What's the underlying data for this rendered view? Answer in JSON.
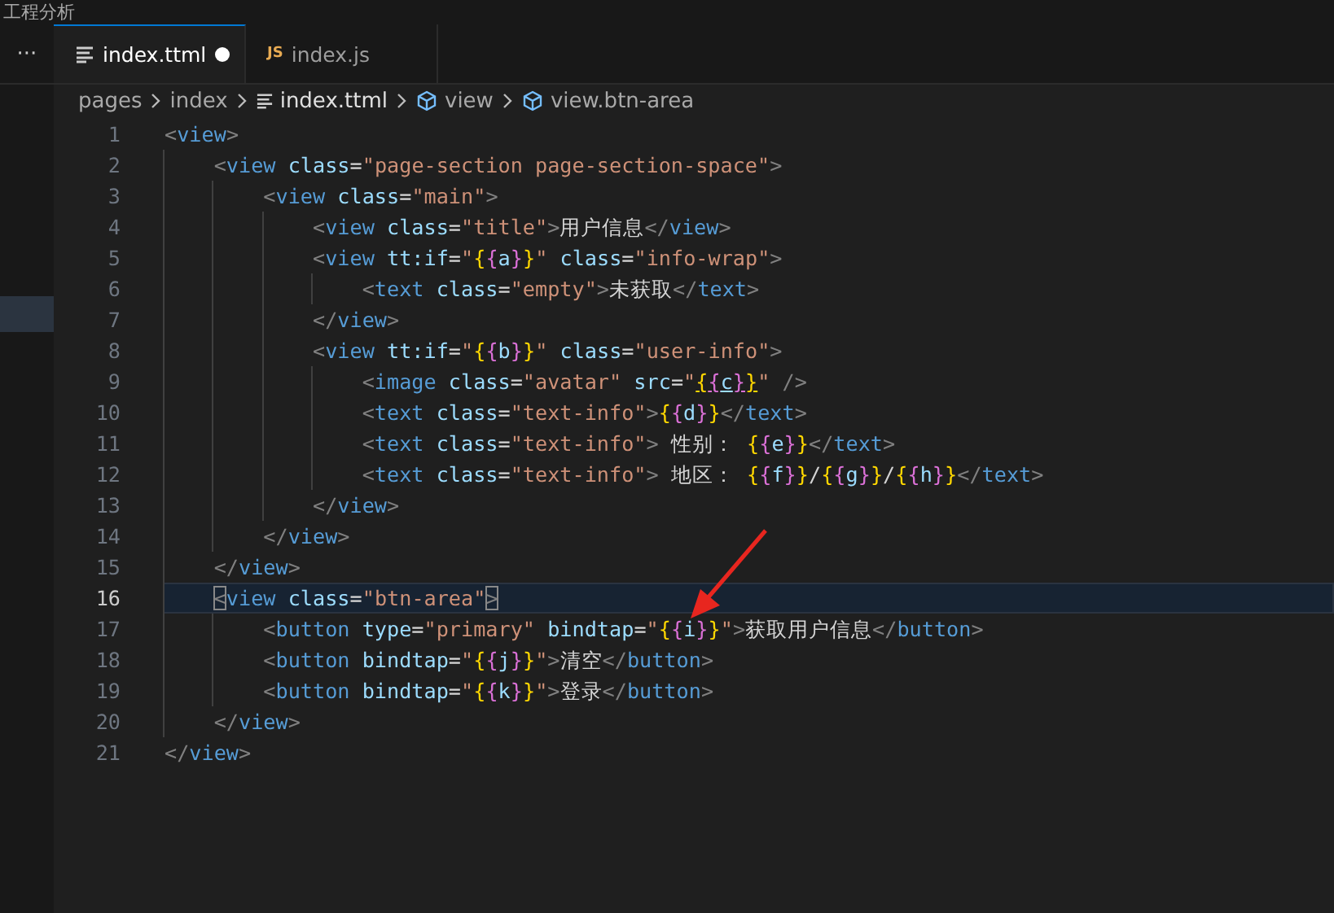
{
  "window": {
    "title": "工程分析"
  },
  "sidebar": {
    "more": "···"
  },
  "tabs": [
    {
      "label": "index.ttml",
      "kind": "markup",
      "selected": true,
      "modified": true
    },
    {
      "label": "index.js",
      "kind": "script",
      "badge": "JS",
      "selected": false,
      "modified": false
    }
  ],
  "breadcrumbs": [
    {
      "label": "pages",
      "kind": "folder"
    },
    {
      "label": "index",
      "kind": "folder"
    },
    {
      "label": "index.ttml",
      "kind": "file"
    },
    {
      "label": "view",
      "kind": "symbol"
    },
    {
      "label": "view.btn-area",
      "kind": "symbol"
    }
  ],
  "code": [
    {
      "number": "1",
      "selected": false,
      "tokens": [
        {
          "kind": "punct",
          "text": "<"
        },
        {
          "kind": "tag",
          "text": "view"
        },
        {
          "kind": "punct",
          "text": ">"
        }
      ],
      "children": [
        {
          "number": "2",
          "selected": false,
          "tokens": [
            {
              "kind": "punct",
              "text": "<"
            },
            {
              "kind": "tag",
              "text": "view"
            },
            {
              "kind": "attr",
              "text": " class"
            },
            {
              "kind": "op",
              "text": "="
            },
            {
              "kind": "str",
              "text": "\"page-section page-section-space\""
            },
            {
              "kind": "punct",
              "text": ">"
            }
          ],
          "children": [
            {
              "number": "3",
              "selected": false,
              "tokens": [
                {
                  "kind": "punct",
                  "text": "<"
                },
                {
                  "kind": "tag",
                  "text": "view"
                },
                {
                  "kind": "attr",
                  "text": " class"
                },
                {
                  "kind": "op",
                  "text": "="
                },
                {
                  "kind": "str",
                  "text": "\"main\""
                },
                {
                  "kind": "punct",
                  "text": ">"
                }
              ],
              "children": [
                {
                  "number": "4",
                  "selected": false,
                  "tokens": [
                    {
                      "kind": "punct",
                      "text": "<"
                    },
                    {
                      "kind": "tag",
                      "text": "view"
                    },
                    {
                      "kind": "attr",
                      "text": " class"
                    },
                    {
                      "kind": "op",
                      "text": "="
                    },
                    {
                      "kind": "str",
                      "text": "\"title\""
                    },
                    {
                      "kind": "punct",
                      "text": ">"
                    },
                    {
                      "kind": "plain",
                      "text": "用户信息"
                    },
                    {
                      "kind": "punct",
                      "text": "</"
                    },
                    {
                      "kind": "tag",
                      "text": "view"
                    },
                    {
                      "kind": "punct",
                      "text": ">"
                    }
                  ]
                },
                {
                  "number": "5",
                  "selected": false,
                  "tokens": [
                    {
                      "kind": "punct",
                      "text": "<"
                    },
                    {
                      "kind": "tag",
                      "text": "view"
                    },
                    {
                      "kind": "attr",
                      "text": " tt:if"
                    },
                    {
                      "kind": "op",
                      "text": "="
                    },
                    {
                      "kind": "str",
                      "text": "\""
                    },
                    {
                      "kind": "brace1",
                      "text": "{"
                    },
                    {
                      "kind": "brace2",
                      "text": "{"
                    },
                    {
                      "kind": "var",
                      "text": "a"
                    },
                    {
                      "kind": "brace2",
                      "text": "}"
                    },
                    {
                      "kind": "brace1",
                      "text": "}"
                    },
                    {
                      "kind": "str",
                      "text": "\""
                    },
                    {
                      "kind": "attr",
                      "text": " class"
                    },
                    {
                      "kind": "op",
                      "text": "="
                    },
                    {
                      "kind": "str",
                      "text": "\"info-wrap\""
                    },
                    {
                      "kind": "punct",
                      "text": ">"
                    }
                  ],
                  "children": [
                    {
                      "number": "6",
                      "selected": false,
                      "tokens": [
                        {
                          "kind": "punct",
                          "text": "<"
                        },
                        {
                          "kind": "tag",
                          "text": "text"
                        },
                        {
                          "kind": "attr",
                          "text": " class"
                        },
                        {
                          "kind": "op",
                          "text": "="
                        },
                        {
                          "kind": "str",
                          "text": "\"empty\""
                        },
                        {
                          "kind": "punct",
                          "text": ">"
                        },
                        {
                          "kind": "plain",
                          "text": "未获取"
                        },
                        {
                          "kind": "punct",
                          "text": "</"
                        },
                        {
                          "kind": "tag",
                          "text": "text"
                        },
                        {
                          "kind": "punct",
                          "text": ">"
                        }
                      ]
                    }
                  ]
                },
                {
                  "number": "7",
                  "selected": false,
                  "tokens": [
                    {
                      "kind": "punct",
                      "text": "</"
                    },
                    {
                      "kind": "tag",
                      "text": "view"
                    },
                    {
                      "kind": "punct",
                      "text": ">"
                    }
                  ]
                },
                {
                  "number": "8",
                  "selected": false,
                  "tokens": [
                    {
                      "kind": "punct",
                      "text": "<"
                    },
                    {
                      "kind": "tag",
                      "text": "view"
                    },
                    {
                      "kind": "attr",
                      "text": " tt:if"
                    },
                    {
                      "kind": "op",
                      "text": "="
                    },
                    {
                      "kind": "str",
                      "text": "\""
                    },
                    {
                      "kind": "brace1",
                      "text": "{"
                    },
                    {
                      "kind": "brace2",
                      "text": "{"
                    },
                    {
                      "kind": "var",
                      "text": "b"
                    },
                    {
                      "kind": "brace2",
                      "text": "}"
                    },
                    {
                      "kind": "brace1",
                      "text": "}"
                    },
                    {
                      "kind": "str",
                      "text": "\""
                    },
                    {
                      "kind": "attr",
                      "text": " class"
                    },
                    {
                      "kind": "op",
                      "text": "="
                    },
                    {
                      "kind": "str",
                      "text": "\"user-info\""
                    },
                    {
                      "kind": "punct",
                      "text": ">"
                    }
                  ],
                  "children": [
                    {
                      "number": "9",
                      "selected": false,
                      "tokens": [
                        {
                          "kind": "punct",
                          "text": "<"
                        },
                        {
                          "kind": "tag",
                          "text": "image"
                        },
                        {
                          "kind": "attr",
                          "text": " class"
                        },
                        {
                          "kind": "op",
                          "text": "="
                        },
                        {
                          "kind": "str",
                          "text": "\"avatar\""
                        },
                        {
                          "kind": "attr",
                          "text": " src"
                        },
                        {
                          "kind": "op",
                          "text": "="
                        },
                        {
                          "kind": "str",
                          "text": "\""
                        },
                        {
                          "kind": "brace1-link",
                          "text": "{"
                        },
                        {
                          "kind": "brace2-link",
                          "text": "{"
                        },
                        {
                          "kind": "var-link",
                          "text": "c"
                        },
                        {
                          "kind": "brace2-link",
                          "text": "}"
                        },
                        {
                          "kind": "brace1-link",
                          "text": "}"
                        },
                        {
                          "kind": "str",
                          "text": "\""
                        },
                        {
                          "kind": "punct",
                          "text": " />"
                        }
                      ]
                    },
                    {
                      "number": "10",
                      "selected": false,
                      "tokens": [
                        {
                          "kind": "punct",
                          "text": "<"
                        },
                        {
                          "kind": "tag",
                          "text": "text"
                        },
                        {
                          "kind": "attr",
                          "text": " class"
                        },
                        {
                          "kind": "op",
                          "text": "="
                        },
                        {
                          "kind": "str",
                          "text": "\"text-info\""
                        },
                        {
                          "kind": "punct",
                          "text": ">"
                        },
                        {
                          "kind": "brace1",
                          "text": "{"
                        },
                        {
                          "kind": "brace2",
                          "text": "{"
                        },
                        {
                          "kind": "var",
                          "text": "d"
                        },
                        {
                          "kind": "brace2",
                          "text": "}"
                        },
                        {
                          "kind": "brace1",
                          "text": "}"
                        },
                        {
                          "kind": "punct",
                          "text": "</"
                        },
                        {
                          "kind": "tag",
                          "text": "text"
                        },
                        {
                          "kind": "punct",
                          "text": ">"
                        }
                      ]
                    },
                    {
                      "number": "11",
                      "selected": false,
                      "tokens": [
                        {
                          "kind": "punct",
                          "text": "<"
                        },
                        {
                          "kind": "tag",
                          "text": "text"
                        },
                        {
                          "kind": "attr",
                          "text": " class"
                        },
                        {
                          "kind": "op",
                          "text": "="
                        },
                        {
                          "kind": "str",
                          "text": "\"text-info\""
                        },
                        {
                          "kind": "punct",
                          "text": ">"
                        },
                        {
                          "kind": "plain",
                          "text": " 性别： "
                        },
                        {
                          "kind": "brace1",
                          "text": "{"
                        },
                        {
                          "kind": "brace2",
                          "text": "{"
                        },
                        {
                          "kind": "var",
                          "text": "e"
                        },
                        {
                          "kind": "brace2",
                          "text": "}"
                        },
                        {
                          "kind": "brace1",
                          "text": "}"
                        },
                        {
                          "kind": "punct",
                          "text": "</"
                        },
                        {
                          "kind": "tag",
                          "text": "text"
                        },
                        {
                          "kind": "punct",
                          "text": ">"
                        }
                      ]
                    },
                    {
                      "number": "12",
                      "selected": false,
                      "tokens": [
                        {
                          "kind": "punct",
                          "text": "<"
                        },
                        {
                          "kind": "tag",
                          "text": "text"
                        },
                        {
                          "kind": "attr",
                          "text": " class"
                        },
                        {
                          "kind": "op",
                          "text": "="
                        },
                        {
                          "kind": "str",
                          "text": "\"text-info\""
                        },
                        {
                          "kind": "punct",
                          "text": ">"
                        },
                        {
                          "kind": "plain",
                          "text": " 地区： "
                        },
                        {
                          "kind": "brace1",
                          "text": "{"
                        },
                        {
                          "kind": "brace2",
                          "text": "{"
                        },
                        {
                          "kind": "var",
                          "text": "f"
                        },
                        {
                          "kind": "brace2",
                          "text": "}"
                        },
                        {
                          "kind": "brace1",
                          "text": "}"
                        },
                        {
                          "kind": "plain",
                          "text": "/"
                        },
                        {
                          "kind": "brace1",
                          "text": "{"
                        },
                        {
                          "kind": "brace2",
                          "text": "{"
                        },
                        {
                          "kind": "var",
                          "text": "g"
                        },
                        {
                          "kind": "brace2",
                          "text": "}"
                        },
                        {
                          "kind": "brace1",
                          "text": "}"
                        },
                        {
                          "kind": "plain",
                          "text": "/"
                        },
                        {
                          "kind": "brace1",
                          "text": "{"
                        },
                        {
                          "kind": "brace2",
                          "text": "{"
                        },
                        {
                          "kind": "var",
                          "text": "h"
                        },
                        {
                          "kind": "brace2",
                          "text": "}"
                        },
                        {
                          "kind": "brace1",
                          "text": "}"
                        },
                        {
                          "kind": "punct",
                          "text": "</"
                        },
                        {
                          "kind": "tag",
                          "text": "text"
                        },
                        {
                          "kind": "punct",
                          "text": ">"
                        }
                      ]
                    }
                  ]
                },
                {
                  "number": "13",
                  "selected": false,
                  "tokens": [
                    {
                      "kind": "punct",
                      "text": "</"
                    },
                    {
                      "kind": "tag",
                      "text": "view"
                    },
                    {
                      "kind": "punct",
                      "text": ">"
                    }
                  ]
                }
              ]
            },
            {
              "number": "14",
              "selected": false,
              "tokens": [
                {
                  "kind": "punct",
                  "text": "</"
                },
                {
                  "kind": "tag",
                  "text": "view"
                },
                {
                  "kind": "punct",
                  "text": ">"
                }
              ]
            }
          ]
        },
        {
          "number": "15",
          "selected": false,
          "tokens": [
            {
              "kind": "punct",
              "text": "</"
            },
            {
              "kind": "tag",
              "text": "view"
            },
            {
              "kind": "punct",
              "text": ">"
            }
          ]
        },
        {
          "number": "16",
          "selected": true,
          "tokens": [
            {
              "kind": "match",
              "text": "<"
            },
            {
              "kind": "tag",
              "text": "view"
            },
            {
              "kind": "attr",
              "text": " class"
            },
            {
              "kind": "op",
              "text": "="
            },
            {
              "kind": "str",
              "text": "\"btn-area\""
            },
            {
              "kind": "match",
              "text": ">"
            }
          ],
          "children": [
            {
              "number": "17",
              "selected": false,
              "tokens": [
                {
                  "kind": "punct",
                  "text": "<"
                },
                {
                  "kind": "tag",
                  "text": "button"
                },
                {
                  "kind": "attr",
                  "text": " type"
                },
                {
                  "kind": "op",
                  "text": "="
                },
                {
                  "kind": "str",
                  "text": "\"primary\""
                },
                {
                  "kind": "attr",
                  "text": " bindtap"
                },
                {
                  "kind": "op",
                  "text": "="
                },
                {
                  "kind": "str",
                  "text": "\""
                },
                {
                  "kind": "brace1",
                  "text": "{"
                },
                {
                  "kind": "brace2",
                  "text": "{"
                },
                {
                  "kind": "var",
                  "text": "i"
                },
                {
                  "kind": "brace2",
                  "text": "}"
                },
                {
                  "kind": "brace1",
                  "text": "}"
                },
                {
                  "kind": "str",
                  "text": "\""
                },
                {
                  "kind": "punct",
                  "text": ">"
                },
                {
                  "kind": "plain",
                  "text": "获取用户信息"
                },
                {
                  "kind": "punct",
                  "text": "</"
                },
                {
                  "kind": "tag",
                  "text": "button"
                },
                {
                  "kind": "punct",
                  "text": ">"
                }
              ]
            },
            {
              "number": "18",
              "selected": false,
              "tokens": [
                {
                  "kind": "punct",
                  "text": "<"
                },
                {
                  "kind": "tag",
                  "text": "button"
                },
                {
                  "kind": "attr",
                  "text": " bindtap"
                },
                {
                  "kind": "op",
                  "text": "="
                },
                {
                  "kind": "str",
                  "text": "\""
                },
                {
                  "kind": "brace1",
                  "text": "{"
                },
                {
                  "kind": "brace2",
                  "text": "{"
                },
                {
                  "kind": "var",
                  "text": "j"
                },
                {
                  "kind": "brace2",
                  "text": "}"
                },
                {
                  "kind": "brace1",
                  "text": "}"
                },
                {
                  "kind": "str",
                  "text": "\""
                },
                {
                  "kind": "punct",
                  "text": ">"
                },
                {
                  "kind": "plain",
                  "text": "清空"
                },
                {
                  "kind": "punct",
                  "text": "</"
                },
                {
                  "kind": "tag",
                  "text": "button"
                },
                {
                  "kind": "punct",
                  "text": ">"
                }
              ]
            },
            {
              "number": "19",
              "selected": false,
              "tokens": [
                {
                  "kind": "punct",
                  "text": "<"
                },
                {
                  "kind": "tag",
                  "text": "button"
                },
                {
                  "kind": "attr",
                  "text": " bindtap"
                },
                {
                  "kind": "op",
                  "text": "="
                },
                {
                  "kind": "str",
                  "text": "\""
                },
                {
                  "kind": "brace1",
                  "text": "{"
                },
                {
                  "kind": "brace2",
                  "text": "{"
                },
                {
                  "kind": "var",
                  "text": "k"
                },
                {
                  "kind": "brace2",
                  "text": "}"
                },
                {
                  "kind": "brace1",
                  "text": "}"
                },
                {
                  "kind": "str",
                  "text": "\""
                },
                {
                  "kind": "punct",
                  "text": ">"
                },
                {
                  "kind": "plain",
                  "text": "登录"
                },
                {
                  "kind": "punct",
                  "text": "</"
                },
                {
                  "kind": "tag",
                  "text": "button"
                },
                {
                  "kind": "punct",
                  "text": ">"
                }
              ]
            }
          ]
        },
        {
          "number": "20",
          "selected": false,
          "tokens": [
            {
              "kind": "punct",
              "text": "</"
            },
            {
              "kind": "tag",
              "text": "view"
            },
            {
              "kind": "punct",
              "text": ">"
            }
          ]
        }
      ]
    },
    {
      "number": "21",
      "selected": false,
      "tokens": [
        {
          "kind": "punct",
          "text": "</"
        },
        {
          "kind": "tag",
          "text": "view"
        },
        {
          "kind": "punct",
          "text": ">"
        }
      ]
    }
  ]
}
